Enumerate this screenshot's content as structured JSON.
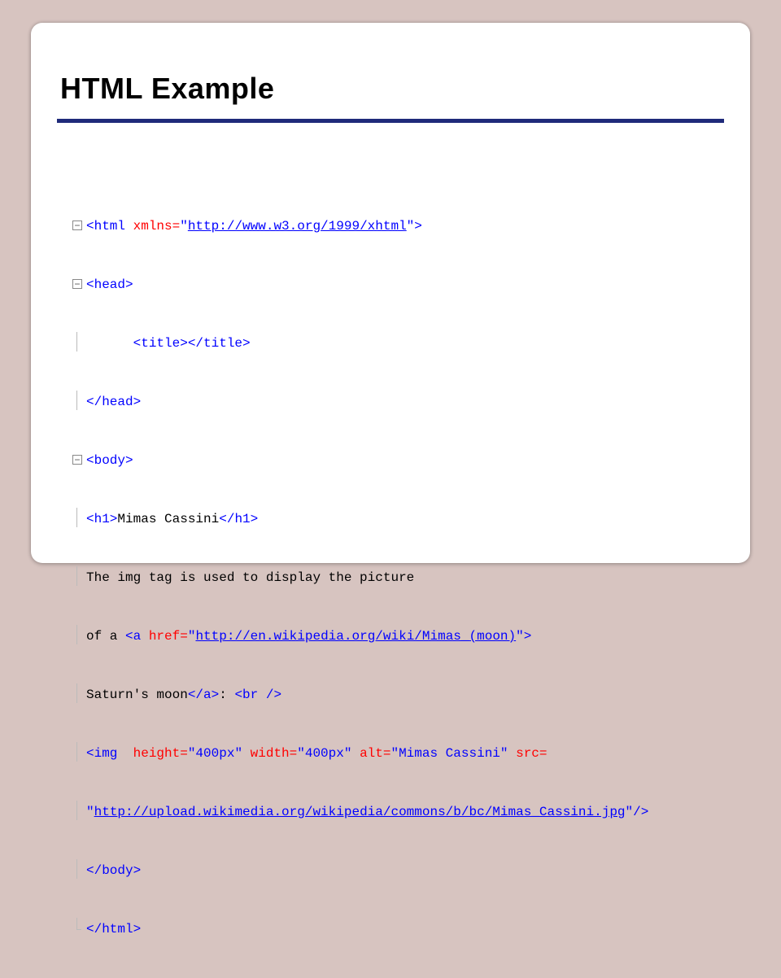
{
  "slide": {
    "title": "HTML Example"
  },
  "code": {
    "l1_tag_open": "<html ",
    "l1_attr": "xmlns=",
    "l1_q1": "\"",
    "l1_link": "http://www.w3.org/1999/xhtml",
    "l1_q2": "\"",
    "l1_close": ">",
    "l2": "<head>",
    "l3_indent": "      ",
    "l3": "<title></title>",
    "l4": "</head>",
    "l5": "<body>",
    "l6_open": "<h1>",
    "l6_text": "Mimas Cassini",
    "l6_close": "</h1>",
    "l7": "The img tag is used to display the picture",
    "l8_text": "of a ",
    "l8_tag": "<a ",
    "l8_attr": "href=",
    "l8_q1": "\"",
    "l8_link": "http://en.wikipedia.org/wiki/Mimas_(moon)",
    "l8_q2": "\"",
    "l8_close": ">",
    "l9_text": "Saturn's moon",
    "l9_tagclose": "</a>",
    "l9_colon": ": ",
    "l9_br": "<br />",
    "l10_tag": "<img  ",
    "l10_attr1": "height=",
    "l10_v1": "\"400px\" ",
    "l10_attr2": "width=",
    "l10_v2": "\"400px\" ",
    "l10_attr3": "alt=",
    "l10_v3": "\"Mimas Cassini\" ",
    "l10_attr4": "src=",
    "l11_q1": "\"",
    "l11_link": "http://upload.wikimedia.org/wikipedia/commons/b/bc/Mimas_Cassini.jpg",
    "l11_q2": "\"",
    "l11_close": "/>",
    "l12": "</body>",
    "l13": "</html>"
  }
}
